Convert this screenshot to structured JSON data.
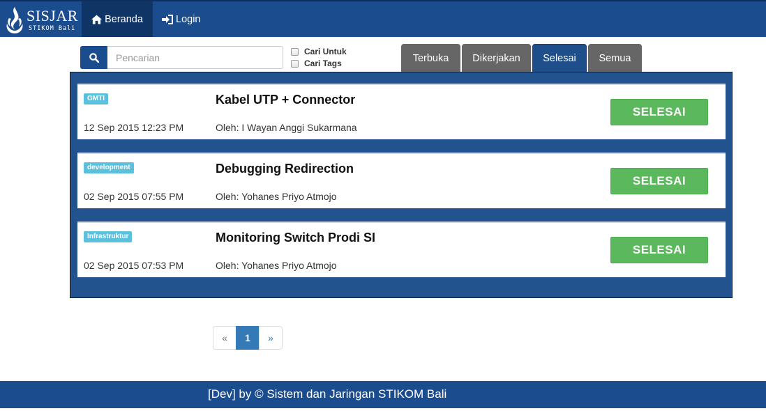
{
  "navbar": {
    "brand_name": "SISJAR",
    "brand_sub": "STIKOM Bali",
    "home_label": "Beranda",
    "login_label": "Login"
  },
  "search": {
    "placeholder": "Pencarian",
    "value": "",
    "option_1": "Cari Untuk",
    "option_2": "Cari Tags"
  },
  "tabs": [
    {
      "label": "Terbuka",
      "active": false
    },
    {
      "label": "Dikerjakan",
      "active": false
    },
    {
      "label": "Selesai",
      "active": true
    },
    {
      "label": "Semua",
      "active": false
    }
  ],
  "tickets": [
    {
      "tag": "GMTI",
      "title": "Kabel UTP + Connector",
      "date": "12 Sep 2015 12:23 PM",
      "author": "Oleh: I Wayan Anggi Sukarmana",
      "status": "SELESAI"
    },
    {
      "tag": "development",
      "title": "Debugging Redirection",
      "date": "02 Sep 2015 07:55 PM",
      "author": "Oleh: Yohanes Priyo Atmojo",
      "status": "SELESAI"
    },
    {
      "tag": "Infrastruktur",
      "title": "Monitoring Switch Prodi SI",
      "date": "02 Sep 2015 07:53 PM",
      "author": "Oleh: Yohanes Priyo Atmojo",
      "status": "SELESAI"
    }
  ],
  "pagination": {
    "prev": "«",
    "current": "1",
    "next": "»"
  },
  "footer": {
    "text": "[Dev] by © Sistem dan Jaringan STIKOM Bali"
  },
  "colors": {
    "navbar": "#1b4d8e",
    "panel": "#23538f",
    "badge": "#5bc0de",
    "done": "#5cb85c",
    "tab_inactive": "#666666"
  },
  "icons": {
    "brand": "flame-logo-icon",
    "home": "home-icon",
    "login": "sign-in-icon",
    "search": "search-icon"
  }
}
